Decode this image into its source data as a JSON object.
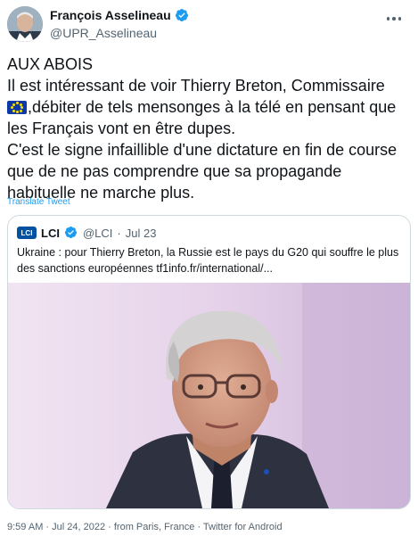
{
  "author": {
    "name": "François Asselineau",
    "handle": "@UPR_Asselineau",
    "avatar_icon": "avatar-photo",
    "verified_icon": "verified-badge-icon"
  },
  "tweet": {
    "lines": [
      "AUX ABOIS",
      "Il est intéressant de voir Thierry Breton, Commissaire",
      ",débiter de tels mensonges à la télé en pensant que",
      "les Français vont en être dupes.",
      "C'est le signe infaillible d'une dictature en fin de course",
      "que de ne pas comprendre que sa propagande",
      "habituelle ne marche plus."
    ],
    "emoji": "eu-flag-emoji",
    "translate_label": "Translate Tweet"
  },
  "quote": {
    "logo_text": "LCI",
    "name": "LCI",
    "handle": "@LCI",
    "separator": "·",
    "date": "Jul 23",
    "text_line1": "Ukraine : pour Thierry Breton, la Russie est le pays du G20 qui souffre le plus",
    "text_line2": "des sanctions européennes tf1info.fr/international/..."
  },
  "meta": {
    "time": "9:59 AM",
    "date": "Jul 24, 2022",
    "location": "from Paris, France",
    "client": "Twitter for Android"
  },
  "colors": {
    "link": "#1d9bf0",
    "secondary_text": "#536471",
    "border": "#cfd9de",
    "verified": "#1d9bf0"
  }
}
